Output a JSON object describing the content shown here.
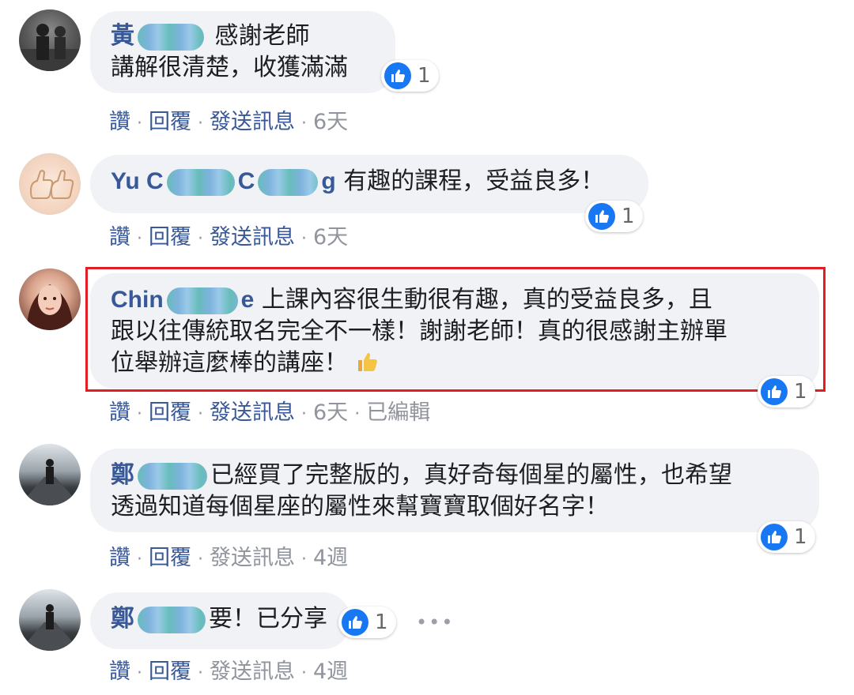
{
  "comments": [
    {
      "author_visible": "黃",
      "author_tail": "",
      "text_line1": "感謝老師",
      "text_line2": "講解很清楚，收獲滿滿",
      "reaction_count": "1",
      "actions": {
        "like": "讚",
        "reply": "回覆",
        "message": "發送訊息",
        "time": "6天"
      }
    },
    {
      "author_visible": "Yu C",
      "author_tail": "g",
      "text": "有趣的課程，受益良多！",
      "reaction_count": "1",
      "actions": {
        "like": "讚",
        "reply": "回覆",
        "message": "發送訊息",
        "time": "6天"
      }
    },
    {
      "author_visible": "Chin",
      "author_tail": "e",
      "text_line1": "上課內容很生動很有趣，真的受益良多，且",
      "text_line2": "跟以往傳統取名完全不一樣！謝謝老師！真的很感謝主辦單",
      "text_line3": "位舉辦這麼棒的講座！",
      "emoji": "👍",
      "reaction_count": "1",
      "actions": {
        "like": "讚",
        "reply": "回覆",
        "message": "發送訊息",
        "time": "6天",
        "edited": "已編輯"
      }
    },
    {
      "author_visible": "鄭",
      "author_tail": "",
      "text_line1": "已經買了完整版的，真好奇每個星的屬性，也希望",
      "text_line2": "透過知道每個星座的屬性來幫寶寶取個好名字！",
      "reaction_count": "1",
      "actions": {
        "like": "讚",
        "reply": "回覆",
        "message": "發送訊息",
        "time": "4週"
      }
    },
    {
      "author_visible": "鄭",
      "author_tail": "",
      "text": "要！已分享",
      "reaction_count": "1",
      "more": "•••",
      "actions": {
        "like": "讚",
        "reply": "回覆",
        "message": "發送訊息",
        "time": "4週"
      }
    }
  ],
  "colors": {
    "link": "#385898",
    "bubble": "#f0f2f5",
    "like_blue": "#1877f2",
    "highlight": "#e21d24"
  }
}
